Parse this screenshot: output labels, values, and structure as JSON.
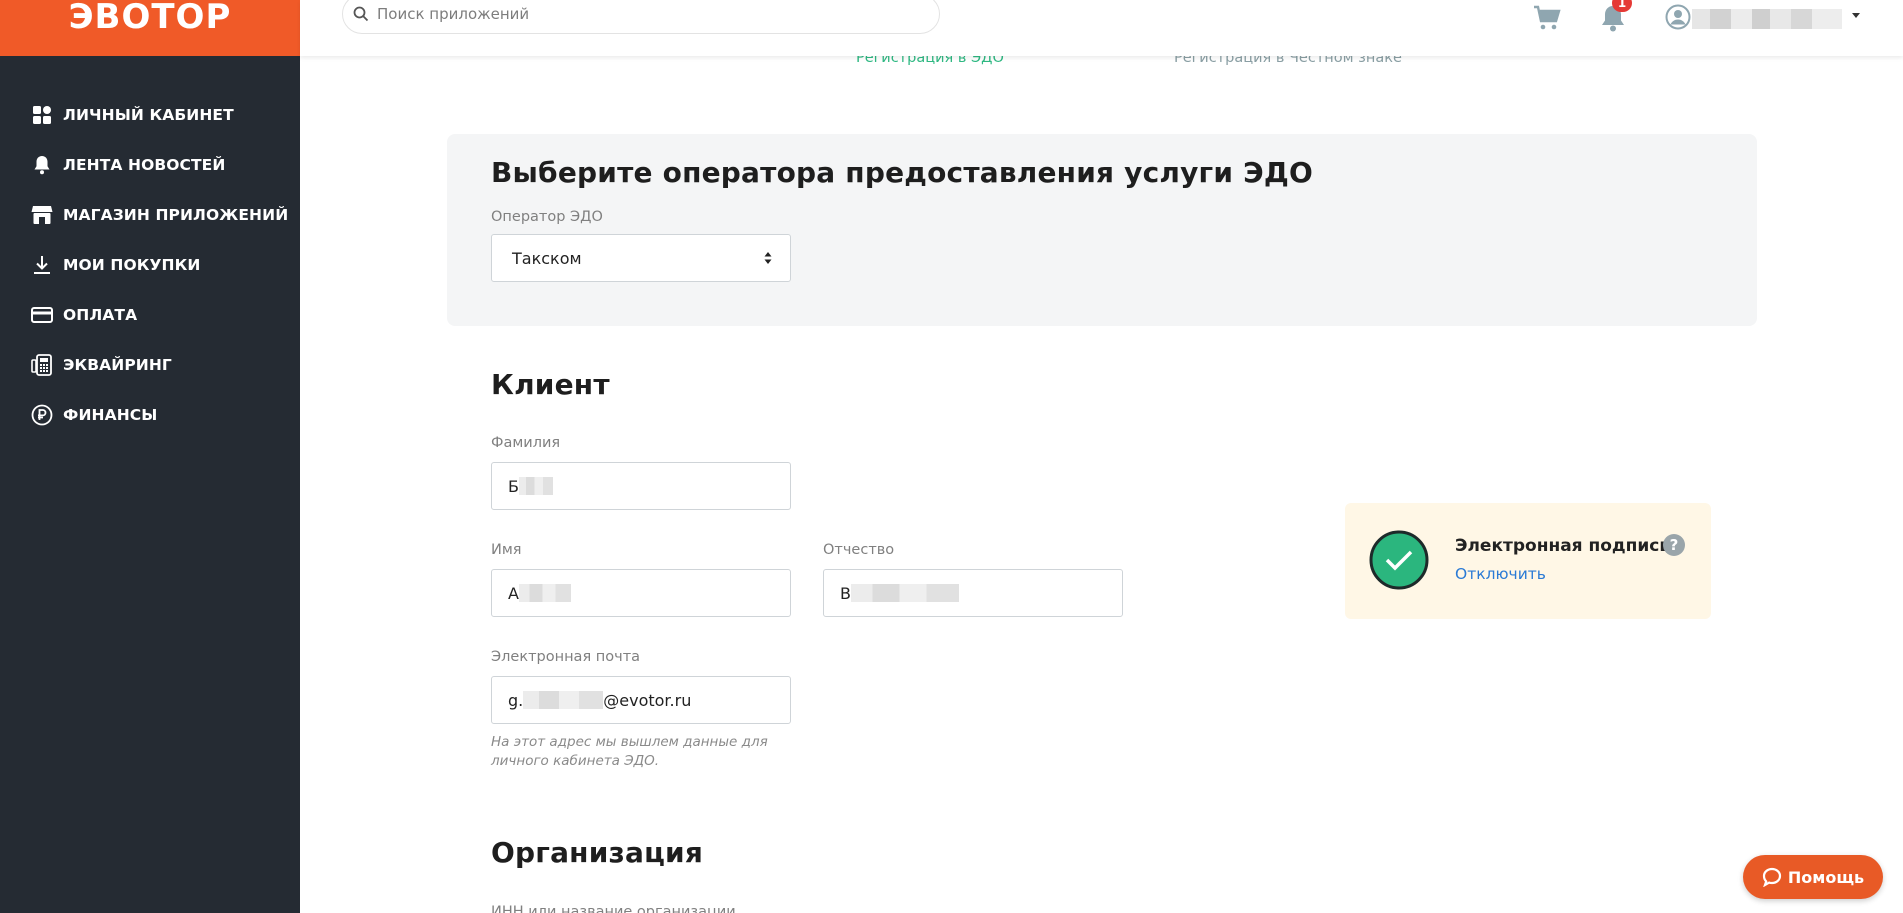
{
  "brand": {
    "logo_text": "ЭВОТОР",
    "accent": "#f05a28",
    "sidebar_bg": "#252b33"
  },
  "sidebar": {
    "items": [
      {
        "label": "ЛИЧНЫЙ КАБИНЕТ",
        "icon": "dashboard-grid-icon"
      },
      {
        "label": "ЛЕНТА НОВОСТЕЙ",
        "icon": "bell-icon"
      },
      {
        "label": "МАГАЗИН ПРИЛОЖЕНИЙ",
        "icon": "store-icon"
      },
      {
        "label": "МОИ ПОКУПКИ",
        "icon": "download-icon"
      },
      {
        "label": "ОПЛАТА",
        "icon": "credit-card-icon"
      },
      {
        "label": "ЭКВАЙРИНГ",
        "icon": "pos-terminal-icon"
      },
      {
        "label": "ФИНАНСЫ",
        "icon": "ruble-icon"
      }
    ]
  },
  "header": {
    "search_placeholder": "Поиск приложений",
    "notifications_count": "1"
  },
  "steps": {
    "step1": "Регистрация в ЭДО",
    "step2": "Регистрация в Честном знаке",
    "active_color": "#2fb983"
  },
  "operator": {
    "title": "Выберите оператора предоставления услуги ЭДО",
    "label": "Оператор ЭДО",
    "selected": "Такском"
  },
  "client": {
    "title": "Клиент",
    "surname_label": "Фамилия",
    "surname_value": "Б",
    "name_label": "Имя",
    "name_value": "А",
    "patronymic_label": "Отчество",
    "patronymic_value": "В",
    "email_label": "Электронная почта",
    "email_prefix": "g.",
    "email_suffix": "@evotor.ru",
    "email_hint": "На этот адрес мы вышлем данные для личного кабинета ЭДО."
  },
  "signature": {
    "title": "Электронная подпись",
    "help": "?",
    "action": "Отключить"
  },
  "organization": {
    "title": "Организация",
    "inn_label": "ИНН или название организации"
  },
  "help_button": {
    "label": "Помощь"
  }
}
